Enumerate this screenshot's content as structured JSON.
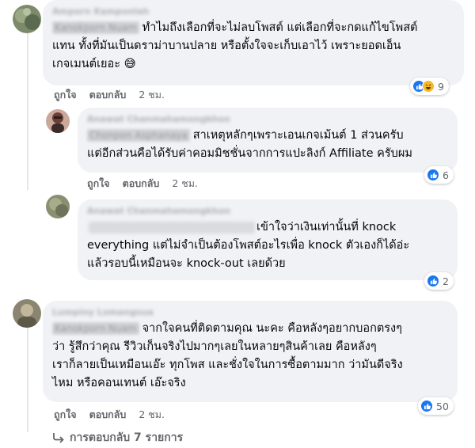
{
  "comments": [
    {
      "author": "Amporn Kamponlah",
      "tag": "Kanokporn Nuam",
      "lines": [
        "ทำไมถึงเลือกที่จะไม่ลบโพสต์ แต่เลือกที่จะกดแก้ไขโพสต์",
        "แทน ทั้งที่มันเป็นดราม่าบานปลาย หรือตั้งใจจะเก็บเอาไว้ เพราะยอดเอ็น",
        "เกจเมนต์เยอะ 😅"
      ],
      "reaction_count": "9",
      "like": "ถูกใจ",
      "reply": "ตอบกลับ",
      "time": "2 ชม."
    },
    {
      "author": "Anawat Chanmahamongkhon",
      "tag": "Chonpon Asphanaya",
      "lines": [
        "สาเหตุหลักๆเพราะเอนเกจเม้นต์ 1 ส่วนครับ",
        "แต่อีกส่วนคือได้รับค่าคอมมิชชั่นจากการแปะลิงก์ Affiliate ครับผม"
      ],
      "reaction_count": "6",
      "like": "ถูกใจ",
      "reply": "ตอบกลับ",
      "time": "2 ชม."
    },
    {
      "author": "Anawat Chanmahamongkhon",
      "tag": "",
      "lines": [
        "เข้าใจว่าเงินเท่านั้นที่ knock",
        "everything แต่ไม่จำเป็นต้องโพสต์อะไรเพื่อ knock ตัวเองก็ได้อ่ะ",
        "แล้วรอบนี้เหมือนจะ knock-out เลยด้วย"
      ],
      "reaction_count": "2",
      "like": "ถูกใจ",
      "reply": "ตอบกลับ",
      "time": "2 ชม."
    },
    {
      "author": "Lumpiny Lomangsua",
      "tag": "Kanokporn Nuam",
      "lines": [
        "จากใจคนที่ติดตามคุณ นะคะ คือหลังๆอยากบอกตรงๆ",
        "ว่า รู้สึกว่าคุณ รีวิวเก็นจริงไปมากๆเลยในหลายๆสินค้าเลย คือหลังๆ",
        "เราก็ลายเป็นเหมือนเอ๊ะ ทุกโพส และชั่งใจในการซื้อตามมาก ว่ามันดีจริง",
        "ไหม หรือคอนเทนต์ เอ๊ะจริง"
      ],
      "reaction_count": "50",
      "like": "ถูกใจ",
      "reply": "ตอบกลับ",
      "time": "2 ชม."
    }
  ],
  "view_replies": "การตอบกลับ 7 รายการ",
  "icons": {
    "like": "thumbs-up-icon",
    "haha": "laughing-emoji-icon",
    "replies": "reply-arrow-icon"
  },
  "colors": {
    "bubble": "#f0f2f5",
    "secondary_text": "#65676b",
    "like_blue": "#1877f2",
    "haha_yellow": "#f7b928"
  }
}
